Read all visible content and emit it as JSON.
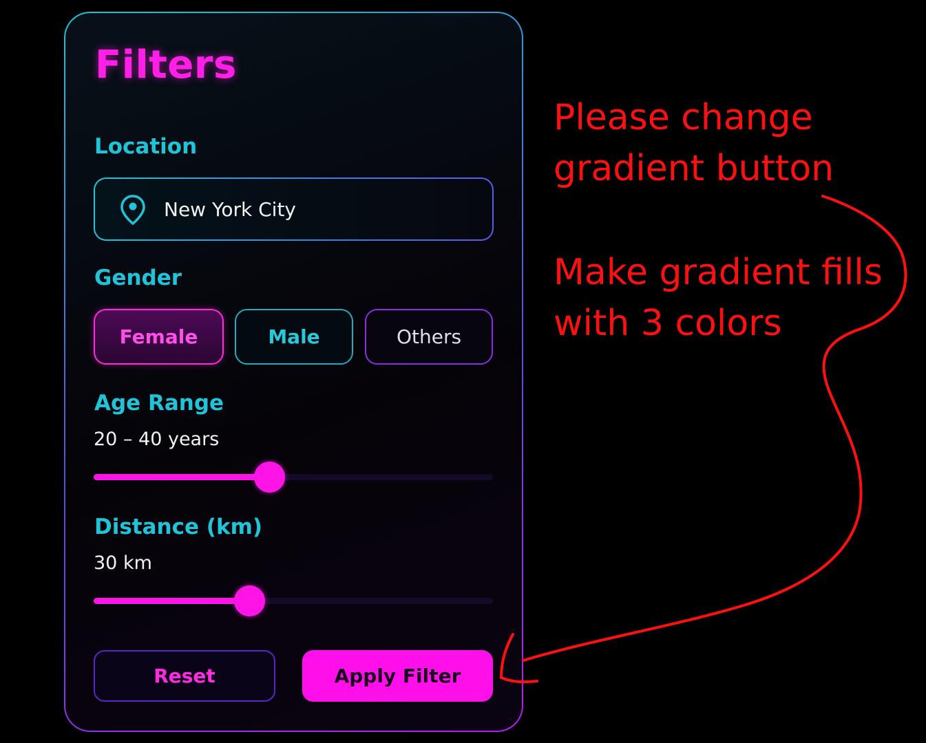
{
  "panel": {
    "title": "Filters"
  },
  "location": {
    "label": "Location",
    "value": "New York City",
    "icon": "map-pin-icon"
  },
  "gender": {
    "label": "Gender",
    "options": [
      {
        "label": "Female",
        "selected": true
      },
      {
        "label": "Male",
        "selected": false
      },
      {
        "label": "Others",
        "selected": false
      }
    ]
  },
  "age_range": {
    "label": "Age Range",
    "value_text": "20 – 40 years",
    "fill_fraction": 0.44
  },
  "distance": {
    "label": "Distance (km)",
    "value_text": "30 km",
    "fill_fraction": 0.39
  },
  "actions": {
    "reset_label": "Reset",
    "apply_label": "Apply Filter"
  },
  "annotation": {
    "line1": "Please change\ngradient button",
    "line2": "Make gradient fills\nwith 3 colors"
  },
  "colors": {
    "accent_magenta": "#ff14e8",
    "accent_cyan": "#1fc4d8",
    "annotation_red": "#ff1010",
    "background": "#000000"
  }
}
